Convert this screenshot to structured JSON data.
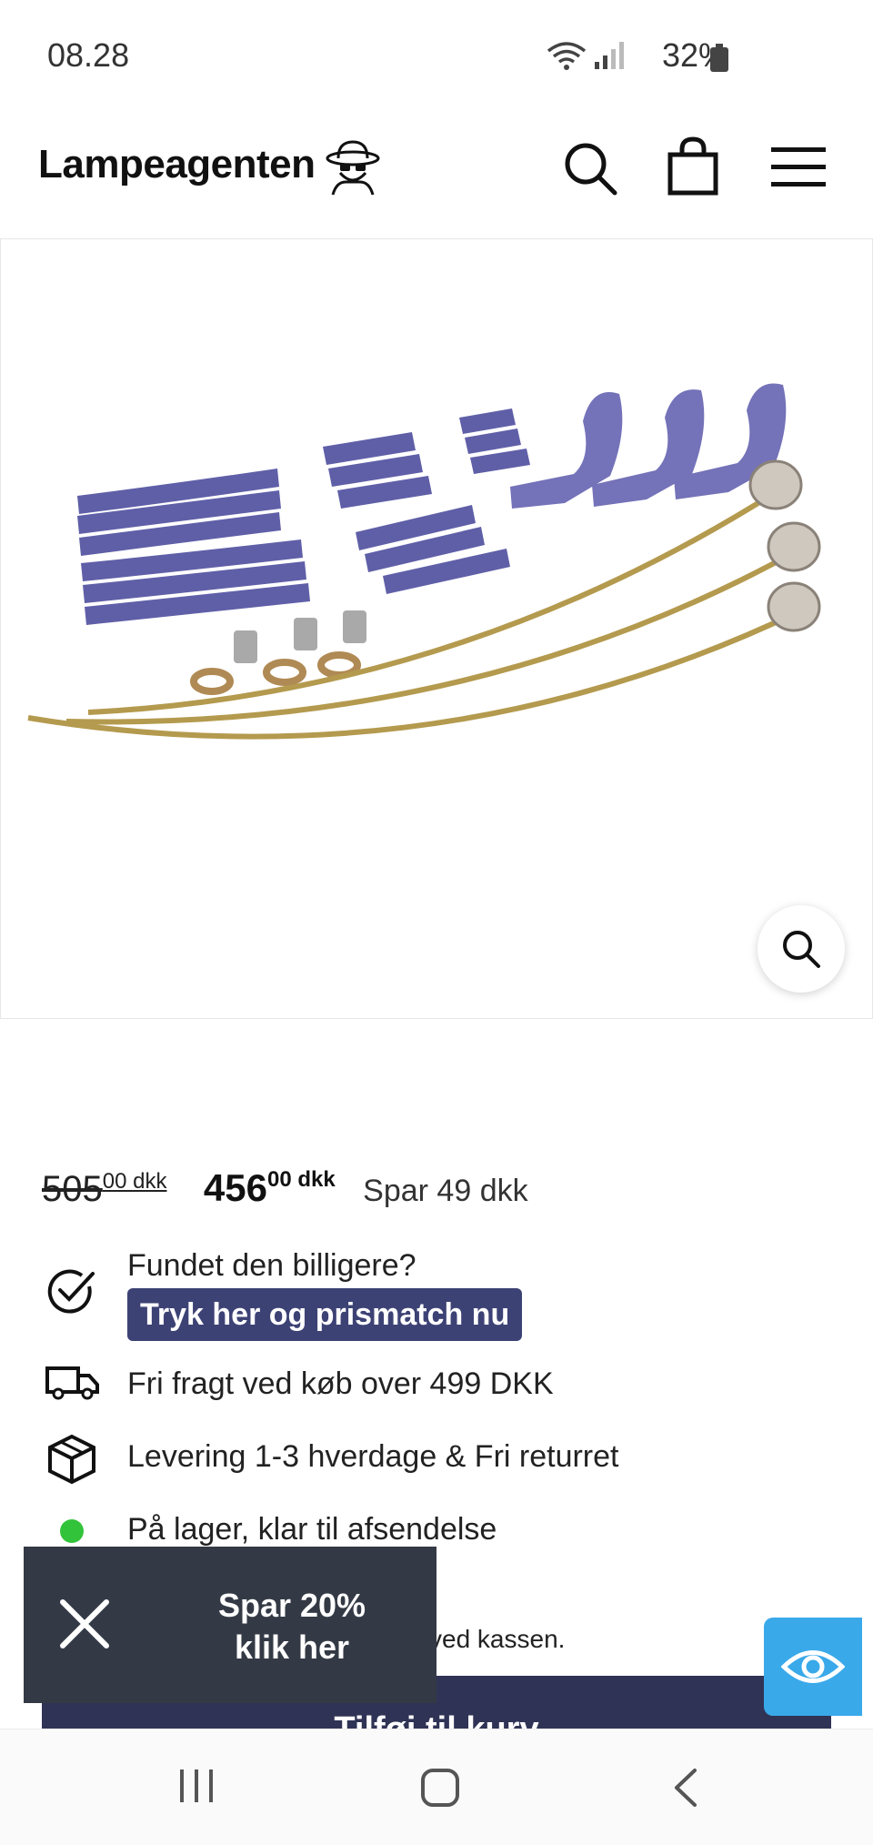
{
  "status_bar": {
    "time": "08.28",
    "battery": "32%"
  },
  "header": {
    "logo": "Lampeagenten"
  },
  "price": {
    "old_main": "505",
    "old_sup": "00 dkk",
    "new_main": "456",
    "new_sup": "00 dkk",
    "savings": "Spar 49 dkk"
  },
  "features": {
    "match_title": "Fundet den billigere?",
    "match_button": "Tryk her og prismatch nu",
    "shipping": "Fri fragt ved køb over 499 DKK",
    "delivery": "Levering 1-3 hverdage & Fri returret",
    "stock": "På lager, klar til afsendelse"
  },
  "checkout_note": "ved kassen.",
  "add_to_cart": "Tilføj til kurv",
  "popup": {
    "line1": "Spar 20%",
    "line2": "klik her"
  },
  "colors": {
    "accent": "#3d4275",
    "button": "#2f3355",
    "popup_bg": "#343a45",
    "stock_green": "#33c33a",
    "accessibility": "#3aa9ea"
  }
}
